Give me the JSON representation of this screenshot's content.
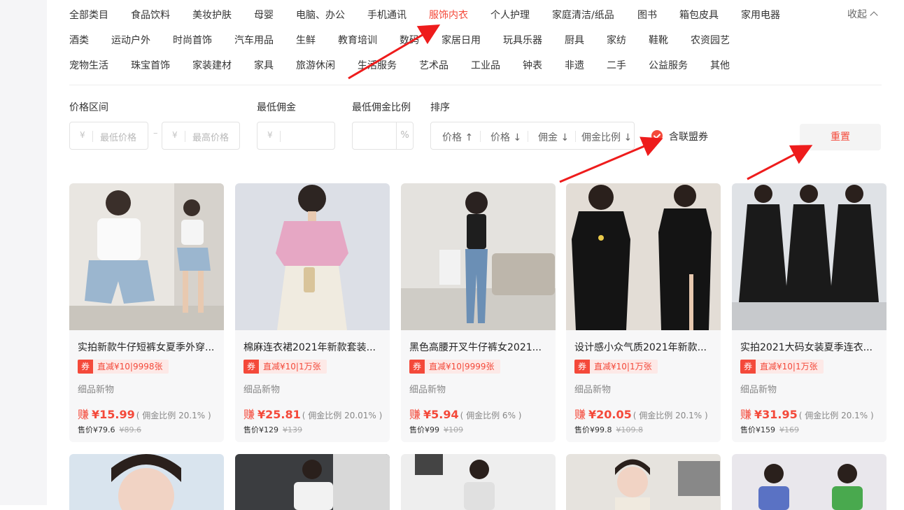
{
  "categories": {
    "row1": [
      "全部类目",
      "食品饮料",
      "美妆护肤",
      "母婴",
      "电脑、办公",
      "手机通讯",
      "服饰内衣",
      "个人护理",
      "家庭清洁/纸品",
      "图书",
      "箱包皮具",
      "家用电器"
    ],
    "row2": [
      "酒类",
      "运动户外",
      "时尚首饰",
      "汽车用品",
      "生鲜",
      "教育培训",
      "数码",
      "家居日用",
      "玩具乐器",
      "厨具",
      "家纺",
      "鞋靴",
      "农资园艺"
    ],
    "row3": [
      "宠物生活",
      "珠宝首饰",
      "家装建材",
      "家具",
      "旅游休闲",
      "生活服务",
      "艺术品",
      "工业品",
      "钟表",
      "非遗",
      "二手",
      "公益服务",
      "其他"
    ],
    "active": "服饰内衣",
    "collapse_label": "收起"
  },
  "filters": {
    "price_label": "价格区间",
    "currency": "¥",
    "min_price_placeholder": "最低价格",
    "max_price_placeholder": "最高价格",
    "min_comm_label": "最低佣金",
    "min_rate_label": "最低佣金比例",
    "percent": "%",
    "sort_label": "排序",
    "sort_options": [
      "价格 ↑",
      "价格 ↓",
      "佣金 ↓",
      "佣金比例 ↓"
    ],
    "coupon_checkbox": "含联盟券",
    "coupon_checked": true,
    "reset_label": "重置"
  },
  "products": [
    {
      "title": "实拍新款牛仔短裤女夏季外穿...",
      "coupon_tag": "券",
      "coupon": "直减¥10|9998张",
      "shop": "细品新物",
      "earn_label": "赚",
      "earn": "¥15.99",
      "rate": "( 佣金比例 20.1% )",
      "sale_price": "售价¥79.6",
      "orig_price": "¥89.6"
    },
    {
      "title": "棉麻连衣裙2021年新款套装...",
      "coupon_tag": "券",
      "coupon": "直减¥10|1万张",
      "shop": "细品新物",
      "earn_label": "赚",
      "earn": "¥25.81",
      "rate": "( 佣金比例 20.01% )",
      "sale_price": "售价¥129",
      "orig_price": "¥139"
    },
    {
      "title": "黑色高腰开叉牛仔裤女2021...",
      "coupon_tag": "券",
      "coupon": "直减¥10|9999张",
      "shop": "细品新物",
      "earn_label": "赚",
      "earn": "¥5.94",
      "rate": "( 佣金比例 6% )",
      "sale_price": "售价¥99",
      "orig_price": "¥109"
    },
    {
      "title": "设计感小众气质2021年新款...",
      "coupon_tag": "券",
      "coupon": "直减¥10|1万张",
      "shop": "细品新物",
      "earn_label": "赚",
      "earn": "¥20.05",
      "rate": "( 佣金比例 20.1% )",
      "sale_price": "售价¥99.8",
      "orig_price": "¥109.8"
    },
    {
      "title": "实拍2021大码女装夏季连衣...",
      "coupon_tag": "券",
      "coupon": "直减¥10|1万张",
      "shop": "细品新物",
      "earn_label": "赚",
      "earn": "¥31.95",
      "rate": "( 佣金比例 20.1% )",
      "sale_price": "售价¥159",
      "orig_price": "¥169"
    }
  ],
  "colors": {
    "accent": "#f4493a",
    "arrow": "#ee1c1c"
  }
}
